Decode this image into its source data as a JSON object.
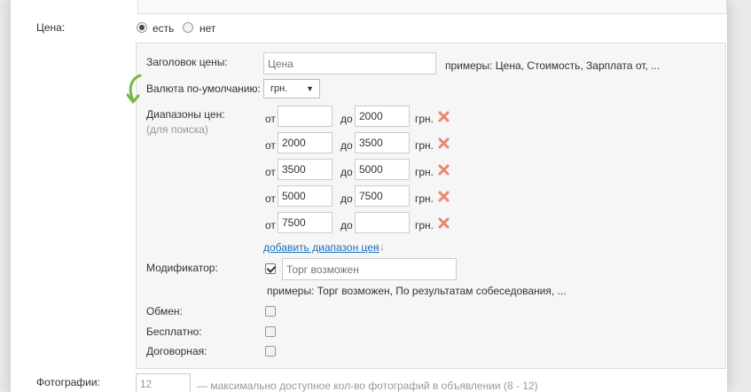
{
  "price": {
    "label": "Цена:",
    "option_yes": "есть",
    "option_no": "нет",
    "selected": "есть"
  },
  "panel": {
    "heading_label": "Заголовок цены:",
    "heading_placeholder": "Цена",
    "heading_examples": "примеры: Цена, Стоимость, Зарплата от, ...",
    "currency_label": "Валюта по-умолчанию:",
    "currency_value": "грн.",
    "ranges_label": "Диапазоны цен:",
    "ranges_hint": "(для поиска)",
    "from_label": "от",
    "to_label": "до",
    "unit": "грн.",
    "ranges": [
      {
        "from": "",
        "to": "2000"
      },
      {
        "from": "2000",
        "to": "3500"
      },
      {
        "from": "3500",
        "to": "5000"
      },
      {
        "from": "5000",
        "to": "7500"
      },
      {
        "from": "7500",
        "to": ""
      }
    ],
    "add_range": "добавить диапазон цен",
    "sort_glyph": "↑↓",
    "modifier_label": "Модификатор:",
    "modifier_checked": true,
    "modifier_placeholder": "Торг возможен",
    "modifier_examples": "примеры: Торг возможен, По результатам собеседования, ...",
    "exchange_label": "Обмен:",
    "free_label": "Бесплатно:",
    "negotiable_label": "Договорная:"
  },
  "photos": {
    "label": "Фотографии:",
    "value": "12",
    "hint": "— максимально доступное кол-во фотографий в объявлении (8 - 12)"
  },
  "colors": {
    "accent_arrow": "#7ab648",
    "remove_icon": "#e8866e",
    "link": "#1a6fbf"
  }
}
